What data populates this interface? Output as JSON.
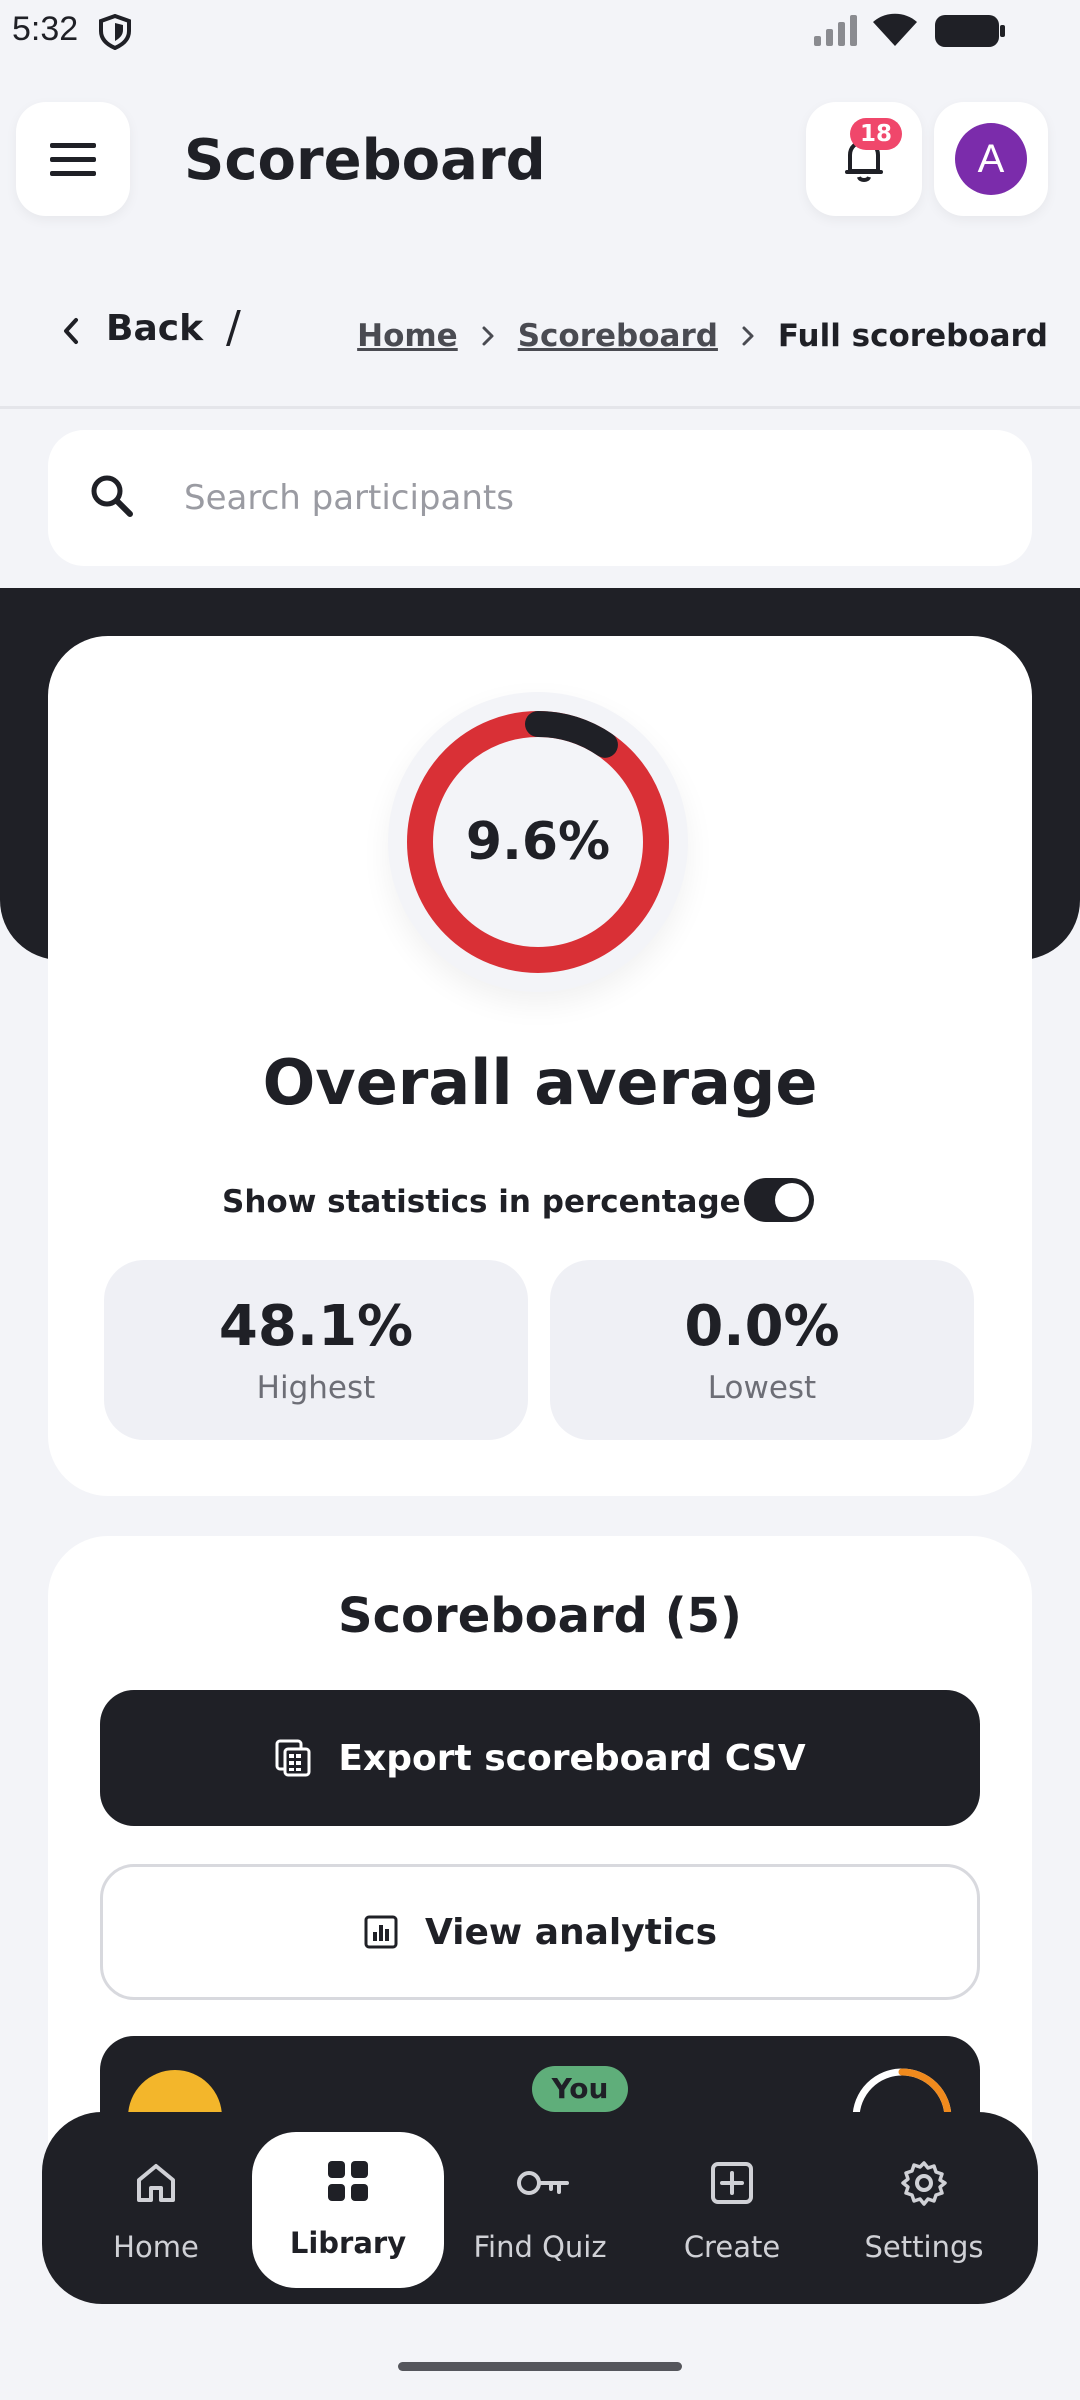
{
  "status_bar": {
    "time": "5:32",
    "icons": [
      "shield-icon",
      "signal-icon",
      "wifi-icon",
      "battery-icon"
    ]
  },
  "header": {
    "menu_icon": "hamburger-menu-icon",
    "title": "Scoreboard",
    "notifications": {
      "icon": "bell-icon",
      "count": "18"
    },
    "avatar_initial": "A",
    "avatar_color": "#7b2cab"
  },
  "breadcrumb": {
    "back_label": "Back",
    "separator": "/",
    "items": [
      {
        "label": "Home"
      },
      {
        "label": "Scoreboard"
      },
      {
        "label": "Full scoreboard"
      }
    ]
  },
  "search": {
    "placeholder": "Search participants",
    "value": ""
  },
  "overall": {
    "value_text": "9.6%",
    "value_fraction": 0.096,
    "title": "Overall average",
    "toggle_label": "Show statistics in percentage",
    "toggle_on": true,
    "highest": {
      "value": "48.1%",
      "label": "Highest"
    },
    "lowest": {
      "value": "0.0%",
      "label": "Lowest"
    },
    "colors": {
      "progress": "#1f2026",
      "track": "#d93036"
    }
  },
  "scoreboard": {
    "title": "Scoreboard (5)",
    "export_label": "Export scoreboard CSV",
    "analytics_label": "View analytics",
    "you_badge": "You"
  },
  "bottom_nav": {
    "items": [
      {
        "label": "Home",
        "icon": "home-icon"
      },
      {
        "label": "Library",
        "icon": "grid-icon",
        "active": true
      },
      {
        "label": "Find Quiz",
        "icon": "key-icon"
      },
      {
        "label": "Create",
        "icon": "plus-square-icon"
      },
      {
        "label": "Settings",
        "icon": "gear-icon"
      }
    ]
  },
  "colors": {
    "background": "#f3f4f8",
    "dark": "#1f2026",
    "badge": "#f0476b",
    "you_badge": "#5fae7a",
    "row_avatar": "#f3b62b"
  }
}
